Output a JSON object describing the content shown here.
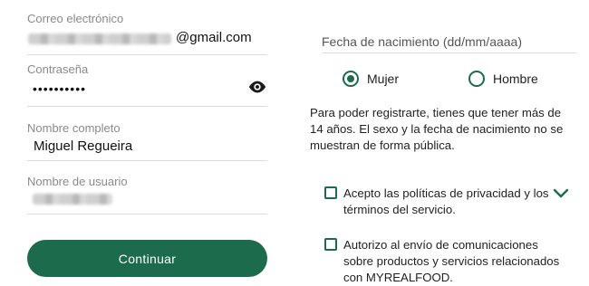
{
  "email": {
    "label": "Correo electrónico",
    "suffix": "@gmail.com"
  },
  "password": {
    "label": "Contraseña",
    "value": "••••••••••"
  },
  "full_name": {
    "label": "Nombre completo",
    "value": "Miguel Regueira"
  },
  "username": {
    "label": "Nombre de usuario"
  },
  "continue_button": "Continuar",
  "dob_placeholder": "Fecha de nacimiento (dd/mm/aaaa)",
  "gender": {
    "female": "Mujer",
    "male": "Hombre",
    "selected": "female"
  },
  "info_text": "Para poder registrarte, tienes que tener más de 14 años. El sexo y la fecha de nacimiento no se muestran de forma pública.",
  "consent": {
    "privacy": "Acepto las políticas de privacidad y los términos del servicio.",
    "marketing": "Autorizo al envío de comunicaciones sobre productos y servicios relacionados con MYREALFOOD."
  },
  "colors": {
    "accent": "#1c6b4c"
  }
}
